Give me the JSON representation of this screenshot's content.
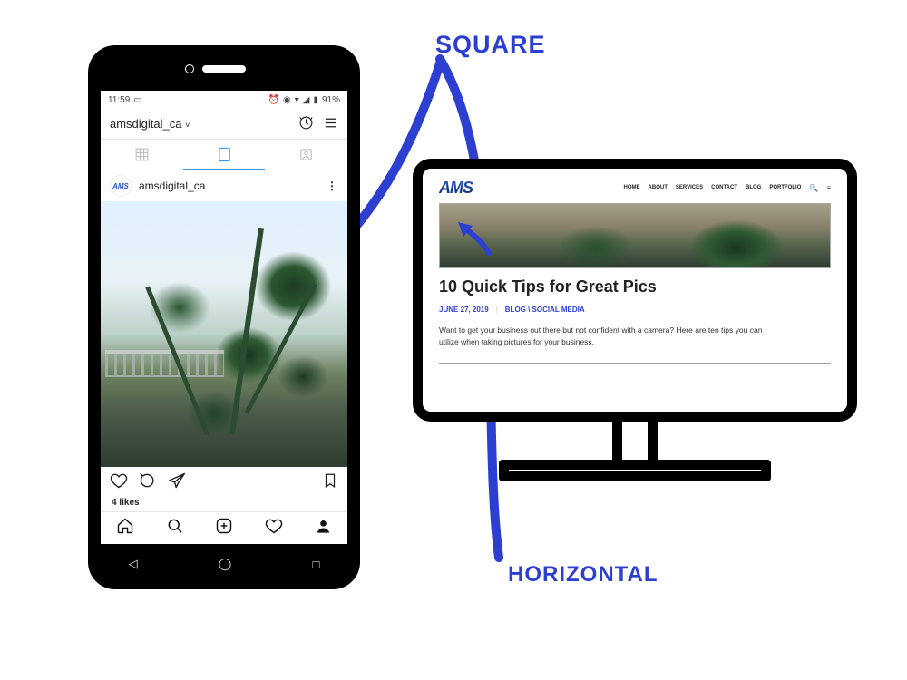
{
  "labels": {
    "square": "SQUARE",
    "horizontal": "HORIZONTAL"
  },
  "colors": {
    "brand_blue": "#2c3fd1",
    "ig_active": "#3897f0"
  },
  "phone": {
    "status": {
      "time": "11:59",
      "battery": "91%"
    },
    "account_handle": "amsdigital_ca",
    "post_author": "amsdigital_ca",
    "likes_text": "4 likes",
    "nav": {
      "back": "◁",
      "home": "◯",
      "recents": "□"
    }
  },
  "site": {
    "logo_text": "AMS",
    "nav_items": [
      "HOME",
      "ABOUT",
      "SERVICES",
      "CONTACT",
      "BLOG",
      "PORTFOLIO"
    ],
    "article": {
      "title": "10 Quick Tips for Great Pics",
      "date": "JUNE 27, 2019",
      "categories": "BLOG \\ SOCIAL MEDIA",
      "excerpt": "Want to get your business out there but not confident with a camera? Here are ten tips you can utilize when taking pictures for your business."
    }
  }
}
